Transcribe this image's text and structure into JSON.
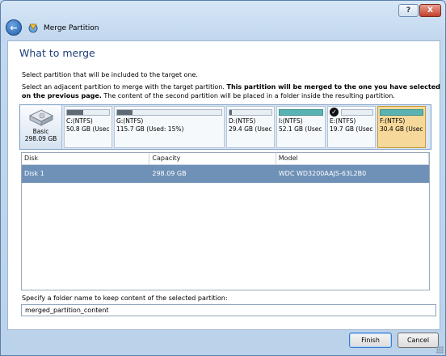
{
  "window": {
    "title": "Merge Partition"
  },
  "caption": {
    "help": "?",
    "close": "X"
  },
  "page": {
    "heading": "What to merge",
    "instruction1": "Select partition that will be included to the target one.",
    "instruction2_a": "Select an adjacent partition to merge with the target partition.",
    "instruction2_b": "This partition will be merged to the one you have selected on the previous page.",
    "instruction2_c": "The content of the second partition will be placed in a folder inside the resulting partition."
  },
  "disk_map": {
    "disk": {
      "label": "Basic",
      "size": "298.09 GB"
    },
    "partitions": [
      {
        "name": "C:(NTFS)",
        "info": "50.8 GB (Usec",
        "used_fraction": 0.38,
        "selected": false,
        "checked": false,
        "style": "gray"
      },
      {
        "name": "G:(NTFS)",
        "info": "115.7 GB (Used: 15%)",
        "used_fraction": 0.15,
        "selected": false,
        "checked": false,
        "style": "gray"
      },
      {
        "name": "D:(NTFS)",
        "info": "29.4 GB (Usec",
        "used_fraction": 0.05,
        "selected": false,
        "checked": false,
        "style": "gray"
      },
      {
        "name": "I:(NTFS)",
        "info": "52.1 GB (Usec",
        "used_fraction": 1.0,
        "selected": false,
        "checked": false,
        "style": "teal"
      },
      {
        "name": "E:(NTFS)",
        "info": "19.7 GB (Usec",
        "used_fraction": 0.0,
        "selected": false,
        "checked": true,
        "style": "gray"
      },
      {
        "name": "F:(NTFS)",
        "info": "30.4 GB (Usec",
        "used_fraction": 1.0,
        "selected": true,
        "checked": false,
        "style": "teal"
      }
    ]
  },
  "table": {
    "headers": [
      "Disk",
      "Capacity",
      "Model"
    ],
    "rows": [
      {
        "disk": "Disk 1",
        "capacity": "298.09 GB",
        "model": "WDC WD3200AAJS-63L2B0"
      }
    ]
  },
  "folder": {
    "label": "Specify a folder name to keep content of the selected partition:",
    "value": "merged_partition_content"
  },
  "buttons": {
    "finish": "Finish",
    "cancel": "Cancel"
  }
}
